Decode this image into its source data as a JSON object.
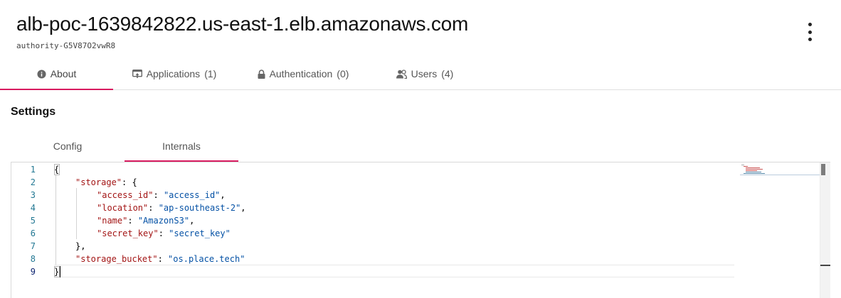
{
  "header": {
    "title": "alb-poc-1639842822.us-east-1.elb.amazonaws.com",
    "subtitle": "authority-G5V87O2vwR8",
    "menu_icon": "more-vert-icon"
  },
  "tabs": [
    {
      "label": "About",
      "count": "",
      "icon": "info-icon",
      "active": true
    },
    {
      "label": "Applications",
      "count": "(1)",
      "icon": "applications-icon",
      "active": false
    },
    {
      "label": "Authentication",
      "count": "(0)",
      "icon": "lock-icon",
      "active": false
    },
    {
      "label": "Users",
      "count": "(4)",
      "icon": "users-icon",
      "active": false
    }
  ],
  "settings": {
    "title": "Settings",
    "subtabs": [
      {
        "label": "Config",
        "active": false
      },
      {
        "label": "Internals",
        "active": true
      }
    ]
  },
  "editor": {
    "line_numbers": [
      "1",
      "2",
      "3",
      "4",
      "5",
      "6",
      "7",
      "8",
      "9"
    ],
    "current_line": "9",
    "lines": [
      {
        "tokens": [
          {
            "t": "p",
            "v": "{"
          }
        ]
      },
      {
        "tokens": [
          {
            "t": "k",
            "v": "\"storage\""
          },
          {
            "t": "p",
            "v": ": {"
          }
        ]
      },
      {
        "tokens": [
          {
            "t": "k",
            "v": "\"access_id\""
          },
          {
            "t": "p",
            "v": ": "
          },
          {
            "t": "s",
            "v": "\"access_id\""
          },
          {
            "t": "p",
            "v": ","
          }
        ]
      },
      {
        "tokens": [
          {
            "t": "k",
            "v": "\"location\""
          },
          {
            "t": "p",
            "v": ": "
          },
          {
            "t": "s",
            "v": "\"ap-southeast-2\""
          },
          {
            "t": "p",
            "v": ","
          }
        ]
      },
      {
        "tokens": [
          {
            "t": "k",
            "v": "\"name\""
          },
          {
            "t": "p",
            "v": ": "
          },
          {
            "t": "s",
            "v": "\"AmazonS3\""
          },
          {
            "t": "p",
            "v": ","
          }
        ]
      },
      {
        "tokens": [
          {
            "t": "k",
            "v": "\"secret_key\""
          },
          {
            "t": "p",
            "v": ": "
          },
          {
            "t": "s",
            "v": "\"secret_key\""
          }
        ]
      },
      {
        "tokens": [
          {
            "t": "p",
            "v": "},"
          }
        ]
      },
      {
        "tokens": [
          {
            "t": "k",
            "v": "\"storage_bucket\""
          },
          {
            "t": "p",
            "v": ": "
          },
          {
            "t": "s",
            "v": "\"os.place.tech\""
          }
        ]
      },
      {
        "tokens": [
          {
            "t": "p",
            "v": "}"
          }
        ]
      }
    ]
  },
  "colors": {
    "accent": "#d81b60",
    "json_key": "#a31515",
    "json_string": "#0451a5",
    "line_number": "#237893"
  }
}
